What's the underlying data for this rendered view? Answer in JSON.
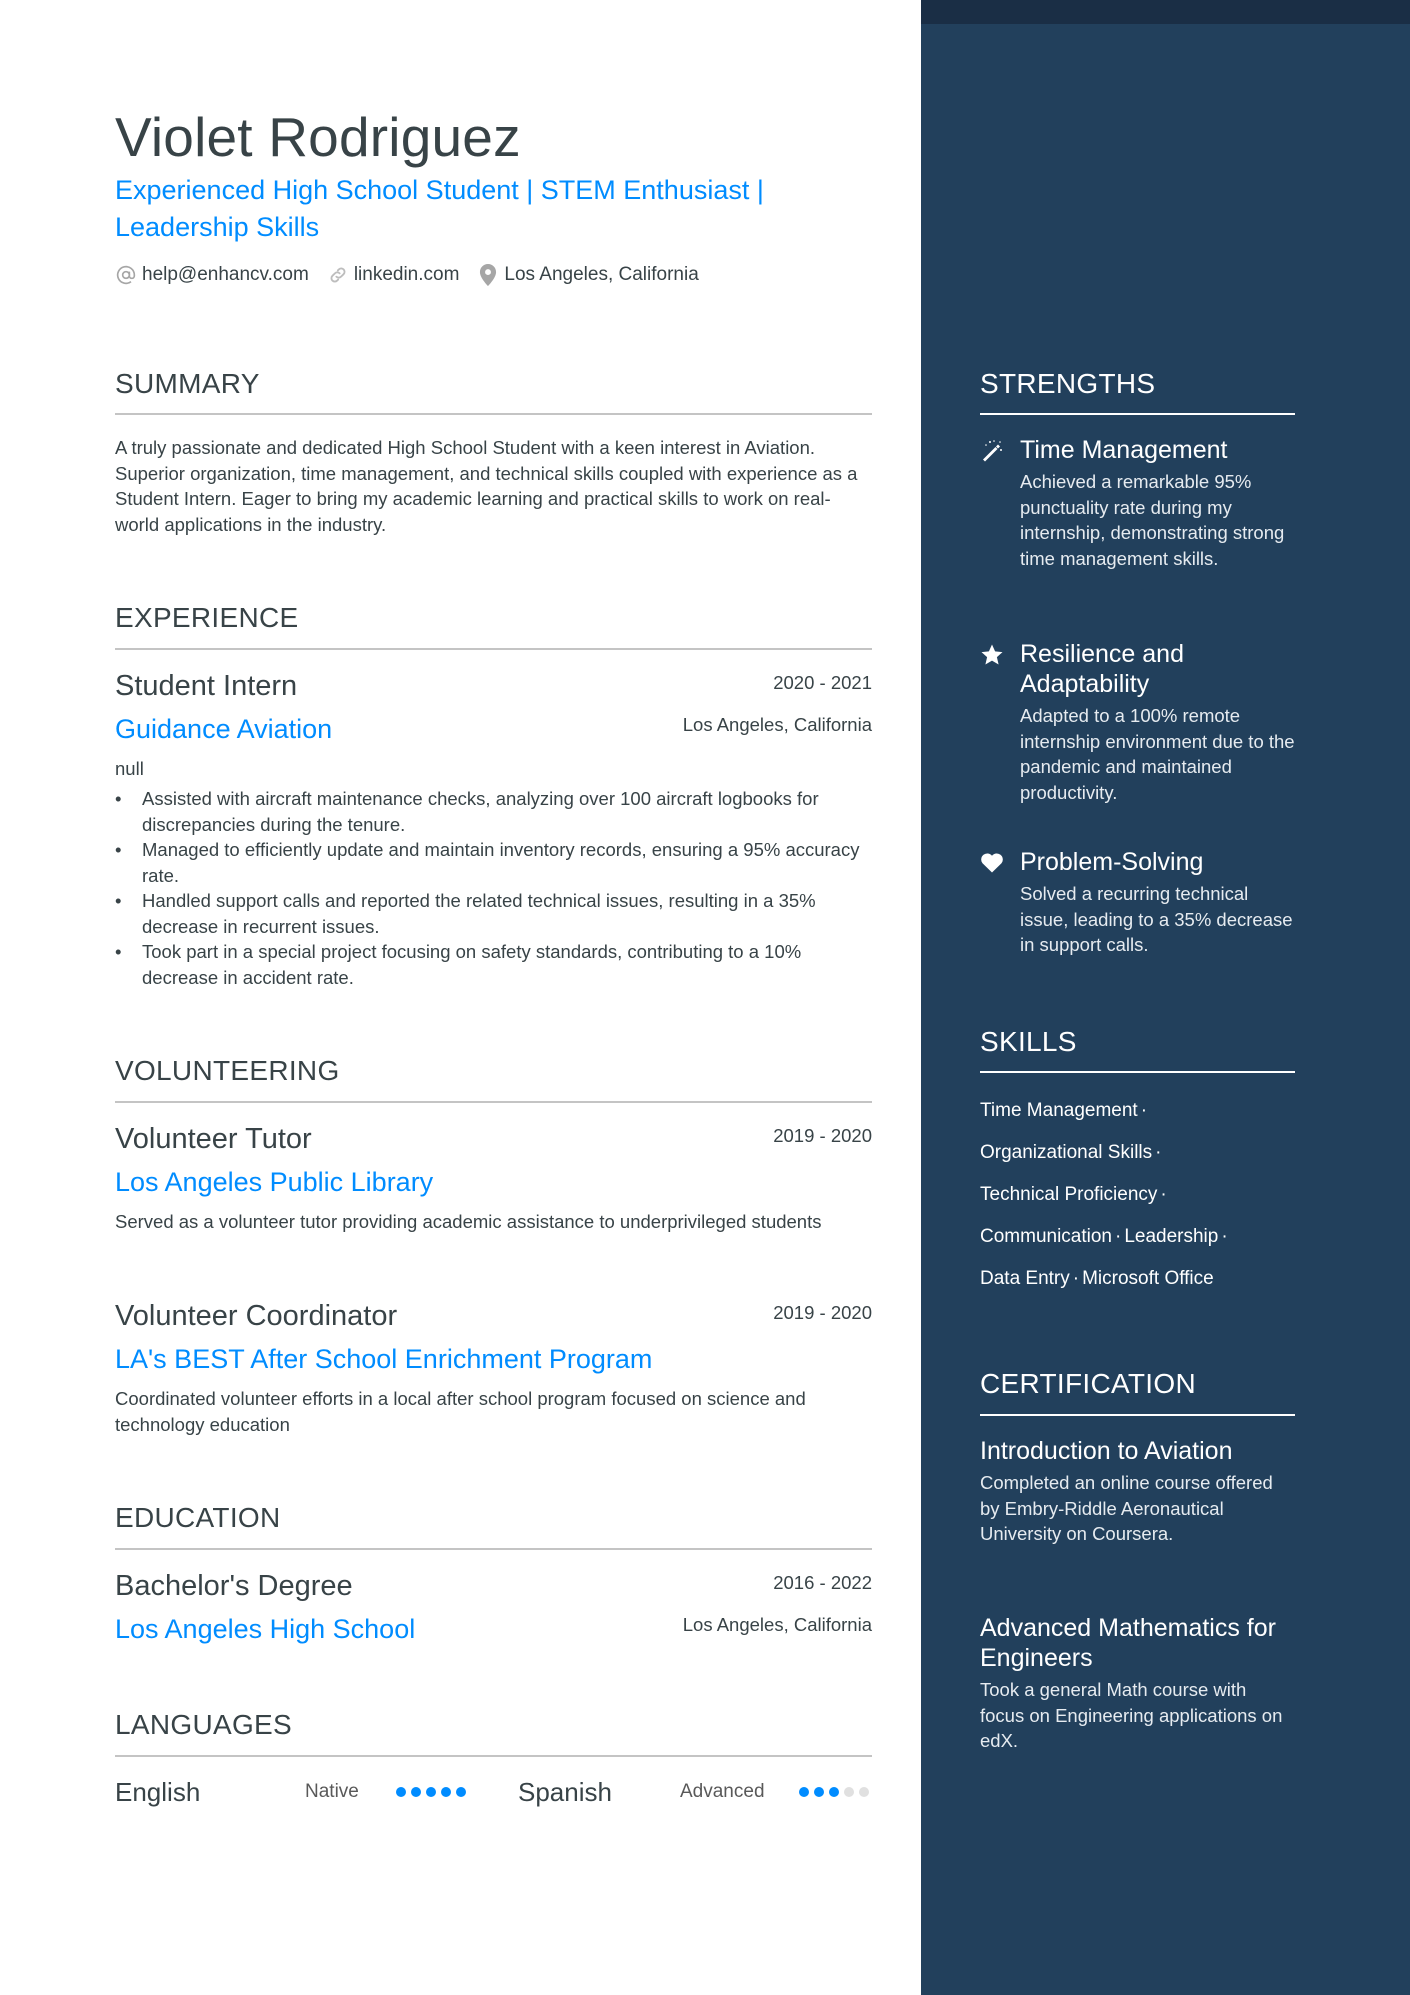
{
  "header": {
    "name": "Violet Rodriguez",
    "headline": "Experienced High School Student | STEM Enthusiast | Leadership Skills",
    "contacts": [
      {
        "icon": "at-icon",
        "text": "help@enhancv.com"
      },
      {
        "icon": "link-icon",
        "text": "linkedin.com"
      },
      {
        "icon": "location-pin-icon",
        "text": "Los Angeles, California"
      }
    ]
  },
  "summary": {
    "title": "SUMMARY",
    "text": "A truly passionate and dedicated High School Student with a keen interest in Aviation. Superior organization, time management, and technical skills coupled with experience as a Student Intern. Eager to bring my academic learning and practical skills to work on real-world applications in the industry."
  },
  "experience": {
    "title": "EXPERIENCE",
    "items": [
      {
        "role": "Student Intern",
        "company": "Guidance Aviation",
        "dates": "2020 - 2021",
        "location": "Los Angeles, California",
        "description": "null",
        "bullets": [
          "Assisted with aircraft maintenance checks, analyzing over 100 aircraft logbooks for discrepancies during the tenure.",
          "Managed to efficiently update and maintain inventory records, ensuring a 95% accuracy rate.",
          "Handled support calls and reported the related technical issues, resulting in a 35% decrease in recurrent issues.",
          "Took part in a special project focusing on safety standards, contributing to a 10% decrease in accident rate."
        ]
      }
    ]
  },
  "volunteering": {
    "title": "VOLUNTEERING",
    "items": [
      {
        "role": "Volunteer Tutor",
        "org": "Los Angeles Public Library",
        "dates": "2019 - 2020",
        "description": "Served as a volunteer tutor providing academic assistance to underprivileged students"
      },
      {
        "role": "Volunteer Coordinator",
        "org": "LA's BEST After School Enrichment Program",
        "dates": "2019 - 2020",
        "description": "Coordinated volunteer efforts in a local after school program focused on science and technology education"
      }
    ]
  },
  "education": {
    "title": "EDUCATION",
    "items": [
      {
        "degree": "Bachelor's Degree",
        "school": "Los Angeles High School",
        "dates": "2016 - 2022",
        "location": "Los Angeles, California"
      }
    ]
  },
  "languages": {
    "title": "LANGUAGES",
    "items": [
      {
        "name": "English",
        "level": "Native",
        "proficiency": 5,
        "max": 5
      },
      {
        "name": "Spanish",
        "level": "Advanced",
        "proficiency": 3,
        "max": 5
      }
    ]
  },
  "strengths": {
    "title": "STRENGTHS",
    "items": [
      {
        "icon": "magic-wand-icon",
        "title": "Time Management",
        "description": "Achieved a remarkable 95% punctuality rate during my internship, demonstrating strong time management skills."
      },
      {
        "icon": "star-icon",
        "title": "Resilience and Adaptability",
        "description": "Adapted to a 100% remote internship environment due to the pandemic and maintained productivity."
      },
      {
        "icon": "heart-icon",
        "title": "Problem-Solving",
        "description": "Solved a recurring technical issue, leading to a 35% decrease in support calls."
      }
    ]
  },
  "skills": {
    "title": "SKILLS",
    "separator": "·",
    "lines": [
      [
        "Time Management"
      ],
      [
        "Organizational Skills"
      ],
      [
        "Technical Proficiency"
      ],
      [
        "Communication",
        "Leadership"
      ],
      [
        "Data Entry",
        "Microsoft Office"
      ]
    ]
  },
  "certification": {
    "title": "CERTIFICATION",
    "items": [
      {
        "title": "Introduction to Aviation",
        "description": "Completed an online course offered by Embry-Riddle Aeronautical University on Coursera."
      },
      {
        "title": "Advanced Mathematics for Engineers",
        "description": "Took a general Math course with focus on Engineering applications on edX."
      }
    ]
  },
  "colors": {
    "accent": "#008cff",
    "sidebar": "#22405c",
    "sidebar_topbar": "#1a2e45",
    "text": "#384347",
    "dot_off": "#e0e0e0"
  }
}
